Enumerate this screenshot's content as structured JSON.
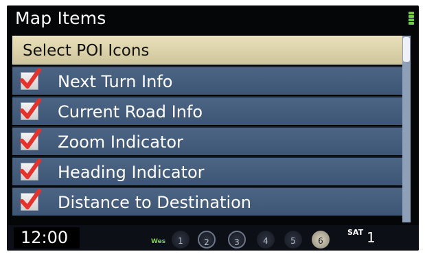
{
  "header": {
    "title": "Map Items"
  },
  "list": {
    "header_label": "Select POI Icons",
    "items": [
      {
        "label": "Next Turn Info",
        "checked": true
      },
      {
        "label": "Current Road Info",
        "checked": true
      },
      {
        "label": "Zoom Indicator",
        "checked": true
      },
      {
        "label": "Heading Indicator",
        "checked": true
      },
      {
        "label": "Distance to Destination",
        "checked": true
      }
    ]
  },
  "statusbar": {
    "clock": "12:00",
    "source_badge": "Wes",
    "presets": [
      "1",
      "2",
      "3",
      "4",
      "5",
      "6"
    ],
    "band": "SAT",
    "channel": "1"
  },
  "colors": {
    "header_row": "#e2d8b0",
    "item_row": "#46607f",
    "check": "#e8312a"
  }
}
